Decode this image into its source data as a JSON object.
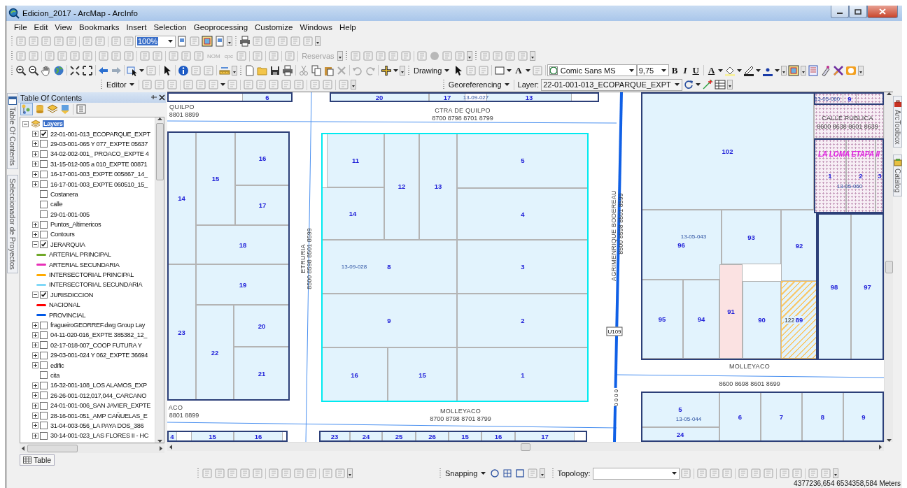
{
  "window": {
    "title": "Edicion_2017 - ArcMap - ArcInfo"
  },
  "menu": [
    "File",
    "Edit",
    "View",
    "Bookmarks",
    "Insert",
    "Selection",
    "Geoprocessing",
    "Customize",
    "Windows",
    "Help"
  ],
  "toolbars": {
    "zoom_percent": "100%",
    "small_labels": [
      "NOM",
      "cpc"
    ],
    "reservas": {
      "label": "Reservas",
      "disabled": true
    },
    "drawing": "Drawing",
    "text_tool": "A",
    "font": "Comic Sans MS",
    "font_size": "9,75",
    "bold": "B",
    "italic": "I",
    "underline": "U",
    "font_color": "A",
    "editor": "Editor",
    "georeferencing": "Georeferencing",
    "layer_label": "Layer:",
    "layer_value": "22-01-001-013_ECOPARQUE_EXPT"
  },
  "side_tabs_left": [
    "Table Of Contents",
    "Seleccionador de Proyectos"
  ],
  "side_tabs_right": [
    "ArcToolbox",
    "Catalog"
  ],
  "toc": {
    "title": "Table Of Contents",
    "tree": {
      "label": "Layers",
      "selected": true,
      "expanded": true,
      "children": [
        {
          "kind": "layer",
          "label": "22-01-001-013_ECOPARQUE_EXPT",
          "checked": true,
          "expanded": false,
          "selected": false
        },
        {
          "kind": "layer",
          "label": "29-03-001-065 Y 077_EXPTE 05637",
          "checked": false,
          "expanded": false,
          "selected": false
        },
        {
          "kind": "layer",
          "label": "34-02-002-001_ PROACO_EXPTE 4",
          "checked": false,
          "expanded": false,
          "selected": false
        },
        {
          "kind": "layer",
          "label": "31-15-012-005 a 010_EXPTE 00871",
          "checked": false,
          "expanded": false,
          "selected": false
        },
        {
          "kind": "layer",
          "label": "16-17-001-003_EXPTE 005867_14_",
          "checked": false,
          "expanded": false,
          "selected": false
        },
        {
          "kind": "layer",
          "label": "16-17-001-003_EXPTE 060510_15_",
          "checked": false,
          "expanded": false,
          "selected": false
        },
        {
          "kind": "layer",
          "label": "Costanera",
          "checked": false,
          "selected": false
        },
        {
          "kind": "layer",
          "label": "calle",
          "checked": false,
          "selected": false
        },
        {
          "kind": "layer",
          "label": "29-01-001-005",
          "checked": false,
          "selected": false
        },
        {
          "kind": "layer",
          "label": "Puntos_Altimericos",
          "checked": false,
          "expanded": false,
          "selected": false
        },
        {
          "kind": "layer",
          "label": "Contours",
          "checked": false,
          "expanded": false,
          "selected": false
        },
        {
          "kind": "layer",
          "label": "JERARQUIA",
          "checked": true,
          "expanded": true,
          "selected": false,
          "children": [
            {
              "kind": "legend",
              "label": "ARTERIAL PRINCIPAL",
              "color": "#70a828"
            },
            {
              "kind": "legend",
              "label": "ARTERIAL SECUNDARIA",
              "color": "#e830b8"
            },
            {
              "kind": "legend",
              "label": "INTERSECTORIAL PRINCIPAL",
              "color": "#ffaa00"
            },
            {
              "kind": "legend",
              "label": "INTERSECTORIAL SECUNDARIA",
              "color": "#80d8f8"
            }
          ]
        },
        {
          "kind": "layer",
          "label": "JURISDICCION",
          "checked": true,
          "expanded": true,
          "selected": false,
          "children": [
            {
              "kind": "legend",
              "label": "NACIONAL",
              "color": "#ff0000"
            },
            {
              "kind": "legend",
              "label": "PROVINCIAL",
              "color": "#0058e6"
            }
          ]
        },
        {
          "kind": "layer",
          "label": "fragueiroGEORREF.dwg Group Lay",
          "checked": false,
          "expanded": false,
          "selected": false
        },
        {
          "kind": "layer",
          "label": "04-11-020-016_EXPTE 385382_12_",
          "checked": false,
          "expanded": false,
          "selected": false
        },
        {
          "kind": "layer",
          "label": "02-17-018-007_COOP FUTURA Y",
          "checked": false,
          "expanded": false,
          "selected": false
        },
        {
          "kind": "layer",
          "label": "29-03-001-024 Y 062_EXPTE 36694",
          "checked": false,
          "expanded": false,
          "selected": false
        },
        {
          "kind": "layer",
          "label": "edific",
          "checked": false,
          "expanded": false,
          "selected": false
        },
        {
          "kind": "layer",
          "label": "cita",
          "checked": false,
          "selected": false
        },
        {
          "kind": "layer",
          "label": "16-32-001-108_LOS ALAMOS_EXP",
          "checked": false,
          "expanded": false,
          "selected": false
        },
        {
          "kind": "layer",
          "label": "26-26-001-012,017,044_CARCANO",
          "checked": false,
          "expanded": false,
          "selected": false
        },
        {
          "kind": "layer",
          "label": "24-01-001-006_SAN JAVIER_EXPTE",
          "checked": false,
          "expanded": false,
          "selected": false
        },
        {
          "kind": "layer",
          "label": "28-16-001-051_AMP CAÑUELAS_E",
          "checked": false,
          "expanded": false,
          "selected": false
        },
        {
          "kind": "layer",
          "label": "31-04-003-056_LA PAYA DOS_386",
          "checked": false,
          "expanded": false,
          "selected": false
        },
        {
          "kind": "layer",
          "label": "30-14-001-023_LAS FLORES II - HC",
          "checked": false,
          "expanded": false,
          "selected": false
        }
      ]
    }
  },
  "table_tab": "Table",
  "map": {
    "blocks": [
      {
        "selected": false,
        "parcels": [
          {
            "label": "6",
            "kind": "plain"
          }
        ]
      },
      {
        "selected": false,
        "code": "13-09-027",
        "parcels": [
          {
            "label": "20",
            "kind": "plain"
          },
          {
            "label": "17",
            "kind": "plain"
          },
          {
            "label": "13",
            "kind": "plain"
          }
        ]
      },
      {
        "selected": false,
        "parcels": [
          {
            "label": "14",
            "kind": "plain"
          },
          {
            "label": "15",
            "kind": "plain"
          },
          {
            "label": "16",
            "kind": "plain"
          },
          {
            "label": "17",
            "kind": "plain"
          },
          {
            "label": "18",
            "kind": "plain"
          },
          {
            "label": "19",
            "kind": "plain"
          },
          {
            "label": "23",
            "kind": "plain"
          },
          {
            "label": "22",
            "kind": "plain"
          },
          {
            "label": "20",
            "kind": "plain"
          },
          {
            "label": "21",
            "kind": "plain"
          }
        ]
      },
      {
        "selected": true,
        "code": "13-09-028",
        "parcels": [
          {
            "label": "11",
            "kind": "plain"
          },
          {
            "label": "14",
            "kind": "plain"
          },
          {
            "label": "12",
            "kind": "plain"
          },
          {
            "label": "13",
            "kind": "plain"
          },
          {
            "label": "5",
            "kind": "plain"
          },
          {
            "label": "4",
            "kind": "plain"
          },
          {
            "label": "8",
            "kind": "plain"
          },
          {
            "label": "3",
            "kind": "plain"
          },
          {
            "label": "9",
            "kind": "plain"
          },
          {
            "label": "2",
            "kind": "plain"
          },
          {
            "label": "16",
            "kind": "plain"
          },
          {
            "label": "15",
            "kind": "plain"
          },
          {
            "label": "1",
            "kind": "plain"
          }
        ]
      },
      {
        "selected": false,
        "parcels": [
          {
            "label": "4",
            "kind": "plain"
          },
          {
            "label": "15",
            "kind": "plain"
          },
          {
            "label": "16",
            "kind": "plain"
          }
        ]
      },
      {
        "selected": false,
        "parcels": [
          {
            "label": "23",
            "kind": "plain"
          },
          {
            "label": "24",
            "kind": "plain"
          },
          {
            "label": "25",
            "kind": "plain"
          },
          {
            "label": "26",
            "kind": "plain"
          },
          {
            "label": "15",
            "kind": "plain"
          },
          {
            "label": "16",
            "kind": "plain"
          },
          {
            "label": "17",
            "kind": "plain"
          }
        ]
      },
      {
        "selected": false,
        "code": "13-05-043",
        "parcels": [
          {
            "label": "102",
            "kind": "plain"
          },
          {
            "label": "96",
            "kind": "plain"
          },
          {
            "label": "93",
            "kind": "plain"
          },
          {
            "label": "92",
            "kind": "plain"
          },
          {
            "label": "95",
            "kind": "plain"
          },
          {
            "label": "94",
            "kind": "plain"
          },
          {
            "label": "91",
            "kind": "highlight"
          },
          {
            "label": "90",
            "kind": "plain"
          },
          {
            "label": "89",
            "kind": "hatched",
            "note": "122"
          }
        ]
      },
      {
        "selected": false,
        "code": "13-05-060",
        "parcels": [
          {
            "label": "9",
            "kind": "dotted"
          }
        ]
      },
      {
        "selected": false,
        "name": "LA LOMA ETAPA II",
        "code": "13-05-060",
        "parcels": [
          {
            "label": "1",
            "kind": "dotted"
          },
          {
            "label": "2",
            "kind": "dotted"
          },
          {
            "label": "3",
            "kind": "dotted"
          }
        ]
      },
      {
        "selected": false,
        "parcels": [
          {
            "label": "98",
            "kind": "plain"
          },
          {
            "label": "97",
            "kind": "plain"
          }
        ]
      },
      {
        "selected": false,
        "code": "13-05-044",
        "parcels": [
          {
            "label": "5",
            "kind": "plain"
          },
          {
            "label": "24",
            "kind": "plain"
          },
          {
            "label": "6",
            "kind": "plain"
          },
          {
            "label": "7",
            "kind": "plain"
          },
          {
            "label": "8",
            "kind": "plain"
          },
          {
            "label": "9",
            "kind": "plain"
          }
        ]
      }
    ],
    "streets": [
      {
        "name": "QUILPO",
        "range": "8801 8899"
      },
      {
        "name": "CTRA DE QUILPO",
        "range": "8700 8798 8701 8799"
      },
      {
        "name": "CALLE PUBLICA",
        "range": "8600 8638 8601 8639"
      },
      {
        "name": "ETRURIA",
        "range": "8500 8598 8501 8599"
      },
      {
        "name": "AGRIMENRIQUE BODEREAU",
        "range": "8500 8598 8501 8599"
      },
      {
        "name": "MOLLEYACO",
        "range": "8600 8698 8601 8699"
      },
      {
        "name": "ACO",
        "range": "8801 8899"
      },
      {
        "name": "MOLLEYACO",
        "range": "8700 8798 8701 8799"
      }
    ],
    "markers": [
      {
        "kind": "shield",
        "text": "U109"
      },
      {
        "kind": "vertical",
        "text": "0000"
      }
    ]
  },
  "bottom_toolbar": {
    "snapping": "Snapping",
    "topology_label": "Topology:"
  },
  "status_bar": {
    "coordinates": "4377236,654 6534358,584 Meters"
  }
}
